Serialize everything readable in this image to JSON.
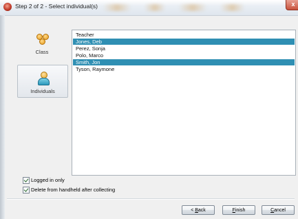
{
  "window": {
    "title": "Step 2 of 2 - Select individual(s)",
    "close_glyph": "x"
  },
  "nav": {
    "items": [
      {
        "label": "Class",
        "icon": "class-group-icon",
        "selected": false
      },
      {
        "label": "Individuals",
        "icon": "individual-person-icon",
        "selected": true
      }
    ]
  },
  "list": {
    "rows": [
      {
        "text": "Teacher",
        "selected": false
      },
      {
        "text": "Jones, Deb",
        "selected": true
      },
      {
        "text": "Perez, Sonja",
        "selected": false
      },
      {
        "text": "Polo, Marco",
        "selected": false
      },
      {
        "text": "Smith, Jon",
        "selected": true
      },
      {
        "text": "Tyson, Raymone",
        "selected": false
      }
    ]
  },
  "options": {
    "logged_in_only": {
      "label": "Logged in only",
      "checked": true
    },
    "delete_after": {
      "label": "Delete from handheld after collecting",
      "checked": true
    }
  },
  "buttons": {
    "back": {
      "prefix": "< ",
      "mnemonic": "B",
      "rest": "ack"
    },
    "finish": {
      "mnemonic": "F",
      "rest": "inish"
    },
    "cancel": {
      "mnemonic": "C",
      "rest": "ancel"
    }
  },
  "colors": {
    "selection": "#2f8fb3",
    "close_button": "#c8523c"
  }
}
